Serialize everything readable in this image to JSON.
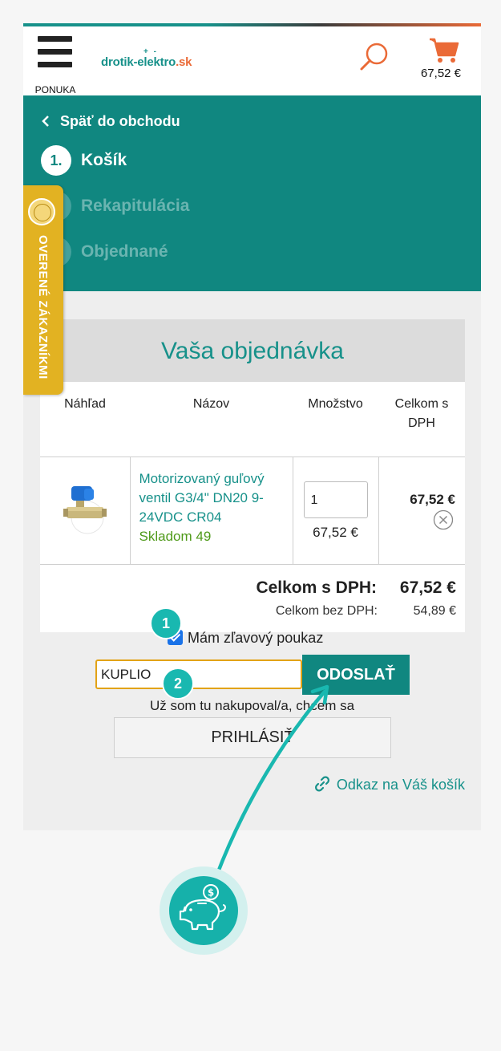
{
  "header": {
    "menu_label": "PONUKA",
    "logo_text": "drotik-elektro",
    "logo_tld": ".sk",
    "logo_mark": "+ -",
    "cart_total": "67,52 €"
  },
  "steps": {
    "back_label": "Späť do obchodu",
    "items": [
      {
        "num": "1.",
        "label": "Košík",
        "state": "active"
      },
      {
        "num": "2.",
        "label": "Rekapitulácia",
        "state": "inactive"
      },
      {
        "num": "3.",
        "label": "Objednané",
        "state": "inactive"
      }
    ]
  },
  "badge": {
    "text": "OVERENÉ ZÁKAZNÍKMI"
  },
  "order": {
    "title": "Vaša objednávka",
    "columns": [
      "Náhľad",
      "Názov",
      "Množstvo",
      "Celkom s DPH"
    ],
    "item": {
      "name": "Motorizovaný guľový ventil G3/4\" DN20 9-24VDC CR04",
      "stock": "Skladom 49",
      "quantity": "1",
      "unit_price": "67,52 €",
      "total": "67,52 €"
    },
    "total_label": "Celkom s DPH:",
    "total_value": "67,52 €",
    "net_label": "Celkom bez DPH:",
    "net_value": "54,89 €"
  },
  "coupon": {
    "checkbox_label": "Mám zľavový poukaz",
    "checked": true,
    "code": "KUPLIO",
    "send_label": "ODOSLAŤ"
  },
  "login": {
    "hint": "Už som tu nakupoval/a, chcem sa",
    "button_label": "PRIHLÁSIŤ"
  },
  "cart_link": {
    "label": "Odkaz na Váš košík"
  },
  "annotations": {
    "badge_1": "1",
    "badge_2": "2"
  },
  "colors": {
    "teal": "#108780",
    "orange": "#ea6a37",
    "coupon_border": "#e2a316",
    "badge_yellow": "#e2b222",
    "annotation": "#19b8b0"
  }
}
